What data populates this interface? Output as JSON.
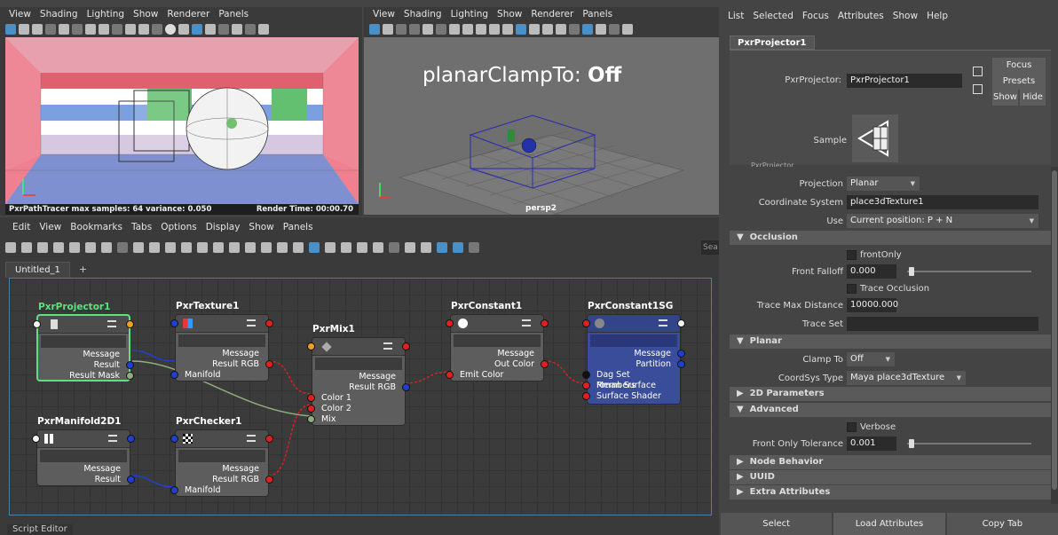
{
  "viewport_menu": [
    "View",
    "Shading",
    "Lighting",
    "Show",
    "Renderer",
    "Panels"
  ],
  "render_view": {
    "status": "PxrPathTracer  max samples: 64  variance: 0.050",
    "render_time": "Render Time: 00:00.70"
  },
  "persp_view": {
    "overlay_prefix": "planarClampTo: ",
    "overlay_value": "Off",
    "camera": "persp2"
  },
  "hypershade_menu": [
    "Edit",
    "View",
    "Bookmarks",
    "Tabs",
    "Options",
    "Display",
    "Show",
    "Panels"
  ],
  "search_placeholder": "Sea",
  "tab": {
    "label": "Untitled_1",
    "add": "+"
  },
  "nodes": {
    "projector": {
      "title": "PxrProjector1",
      "rows": [
        "Message",
        "Result",
        "Result Mask"
      ]
    },
    "texture": {
      "title": "PxrTexture1",
      "rows": [
        "Message",
        "Result RGB",
        "Manifold"
      ]
    },
    "mix": {
      "title": "PxrMix1",
      "rows": [
        "Message",
        "Result RGB",
        "Color 1",
        "Color 2",
        "Mix"
      ]
    },
    "constant": {
      "title": "PxrConstant1",
      "rows": [
        "Message",
        "Out Color",
        "Emit Color"
      ]
    },
    "sg": {
      "title": "PxrConstant1SG",
      "rows": [
        "Message",
        "Partition",
        "Dag Set Members",
        "Rman Surface",
        "Surface Shader"
      ]
    },
    "manifold": {
      "title": "PxrManifold2D1",
      "rows": [
        "Message",
        "Result"
      ]
    },
    "checker": {
      "title": "PxrChecker1",
      "rows": [
        "Message",
        "Result RGB",
        "Manifold"
      ]
    }
  },
  "script_editor": "Script Editor",
  "attribute_editor": {
    "menu": [
      "List",
      "Selected",
      "Focus",
      "Attributes",
      "Show",
      "Help"
    ],
    "tab": "PxrProjector1",
    "type_label": "PxrProjector:",
    "node_name": "PxrProjector1",
    "buttons": {
      "focus": "Focus",
      "presets": "Presets",
      "show": "Show",
      "hide": "Hide"
    },
    "sample_label": "Sample",
    "cut_header": "PxrProjector",
    "projection": {
      "label": "Projection",
      "value": "Planar"
    },
    "coordinate_system": {
      "label": "Coordinate System",
      "value": "place3dTexture1"
    },
    "use": {
      "label": "Use",
      "value": "Current position: P + N"
    },
    "occlusion": {
      "header": "Occlusion",
      "front_only": "frontOnly",
      "front_falloff": {
        "label": "Front Falloff",
        "value": "0.000",
        "level": 0.0
      },
      "trace_occlusion": "Trace Occlusion",
      "trace_max_distance": {
        "label": "Trace Max Distance",
        "value": "10000.000"
      },
      "trace_set": {
        "label": "Trace Set",
        "value": ""
      }
    },
    "planar": {
      "header": "Planar",
      "clamp_to": {
        "label": "Clamp To",
        "value": "Off"
      },
      "coordsys_type": {
        "label": "CoordSys Type",
        "value": "Maya place3dTexture"
      }
    },
    "params_2d": "2D Parameters",
    "advanced": {
      "header": "Advanced",
      "verbose": "Verbose",
      "front_only_tolerance": {
        "label": "Front Only Tolerance",
        "value": "0.001",
        "level": 0.001
      }
    },
    "node_behavior": "Node Behavior",
    "uuid": "UUID",
    "extra_attributes": "Extra Attributes",
    "footer": {
      "select": "Select",
      "load": "Load Attributes",
      "copy": "Copy Tab"
    }
  }
}
